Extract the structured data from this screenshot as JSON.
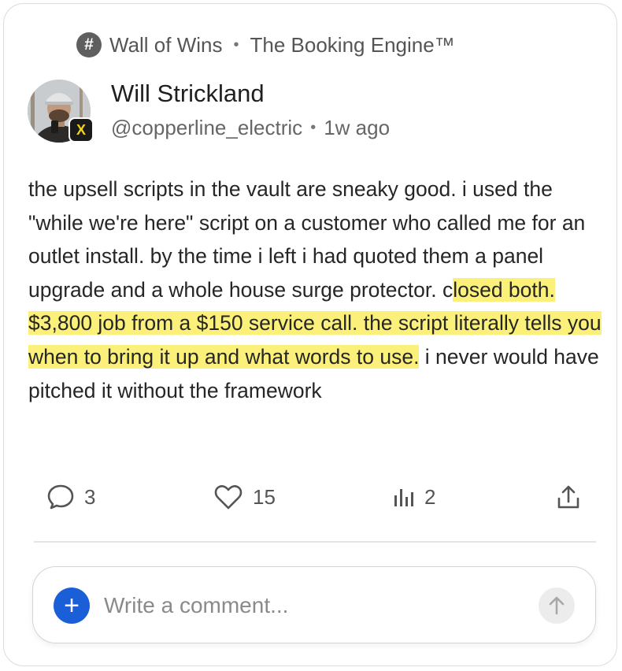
{
  "channel": {
    "name": "Wall of Wins",
    "space": "The Booking Engine™"
  },
  "post": {
    "author": "Will Strickland",
    "handle": "@copperline_electric",
    "time": "1w ago",
    "body_before": "the upsell scripts in the vault are sneaky good. i used the \"while we're here\" script on a customer who called me for an outlet install. by the time i left i had quoted them a panel upgrade and a whole house surge protector. c",
    "body_highlight": "losed both. $3,800 job from a $150 service call. the script literally tells you when to bring it up and what words to use.",
    "body_after": " i never would have pitched it without the framework"
  },
  "actions": {
    "comments": "3",
    "likes": "15",
    "views": "2"
  },
  "composer": {
    "placeholder": "Write a comment..."
  },
  "colors": {
    "highlight": "#fbf17a",
    "accent": "#1a5fd8"
  },
  "icons": {
    "channel": "hash-icon",
    "badge": "brand-badge-icon",
    "comments": "comment-bubble-icon",
    "likes": "heart-icon",
    "views": "bar-chart-icon",
    "share": "share-upload-icon",
    "add": "plus-icon",
    "send": "arrow-up-icon"
  }
}
